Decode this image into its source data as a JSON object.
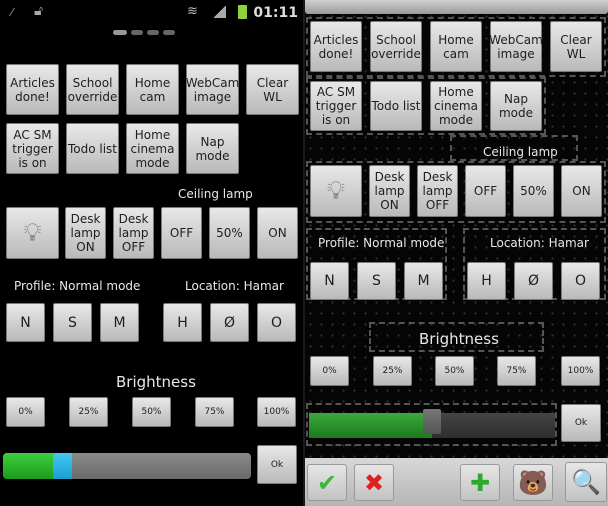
{
  "status_bar": {
    "time": "01:11",
    "icons": [
      "usb-debug-icon",
      "unlock-icon",
      "wifi-icon",
      "signal-icon",
      "battery-icon"
    ]
  },
  "home_dots": {
    "count": 4,
    "active": 0
  },
  "macros_row1": [
    "Articles done!",
    "School override",
    "Home cam",
    "WebCam image",
    "Clear WL"
  ],
  "macros_row2": [
    "AC SM trigger is on",
    "Todo list",
    "Home cinema mode",
    "Nap mode"
  ],
  "ceiling_lamp": {
    "label": "Ceiling lamp",
    "buttons": [
      "OFF",
      "50%",
      "ON"
    ]
  },
  "desk_lamp": {
    "on": "Desk lamp ON",
    "off": "Desk lamp OFF",
    "icon": "lightbulb-icon"
  },
  "profile": {
    "label": "Profile: Normal mode",
    "buttons": [
      "N",
      "S",
      "M"
    ]
  },
  "location": {
    "label": "Location: Hamar",
    "buttons": [
      "H",
      "Ø",
      "O"
    ]
  },
  "brightness": {
    "label": "Brightness",
    "presets": [
      "0%",
      "25%",
      "50%",
      "75%",
      "100%"
    ],
    "ok_label": "Ok",
    "left_value": 0.22,
    "right_value": 0.5
  },
  "edit_toolbar": {
    "buttons": [
      "confirm",
      "cancel",
      "add",
      "bear-widget",
      "zoom"
    ],
    "glyphs": {
      "confirm": "✔",
      "cancel": "✖",
      "add": "✚",
      "bear-widget": "🐻",
      "zoom": "🔍"
    }
  },
  "colors": {
    "slider_fill": "#2fbf2f",
    "slider_thumb": "#2ab0e0",
    "button_face": "#d0d0d0"
  }
}
